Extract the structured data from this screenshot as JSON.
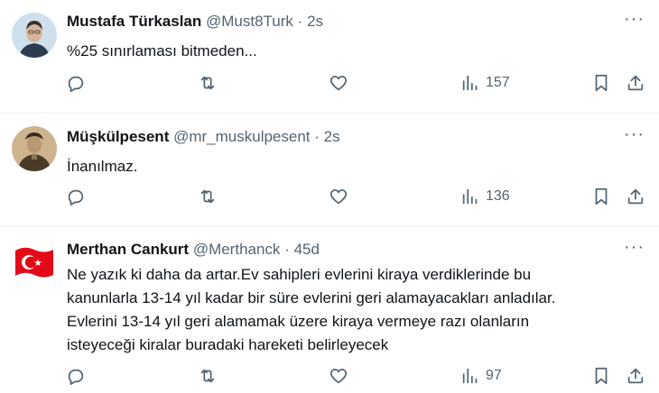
{
  "tweets": [
    {
      "name": "Mustafa Türkaslan",
      "handle": "@Must8Turk",
      "time": "2s",
      "lines": [
        "%25 sınırlaması bitmeden..."
      ],
      "views": "157"
    },
    {
      "name": "Müşkülpesent",
      "handle": "@mr_muskulpesent",
      "time": "2s",
      "lines": [
        "İnanılmaz."
      ],
      "views": "136"
    },
    {
      "name": "Merthan Cankurt",
      "handle": "@Merthanck",
      "time": "45d",
      "lines": [
        "Ne yazık ki daha da artar.Ev sahipleri evlerini kiraya verdiklerinde bu",
        "kanunlarla 13-14 yıl kadar bir süre evlerini geri alamayacakları anladılar.",
        "Evlerini 13-14 yıl geri alamamak üzere kiraya vermeye razı olanların",
        "isteyeceği kiralar buradaki hareketi belirleyecek"
      ],
      "views": "97"
    }
  ],
  "ui": {
    "separator": "·",
    "more": "···"
  },
  "icons": [
    "reply-icon",
    "retweet-icon",
    "like-icon",
    "views-icon",
    "bookmark-icon",
    "share-icon",
    "more-icon"
  ],
  "colors": {
    "text": "#0f1419",
    "muted": "#536471",
    "border": "#eff3f4",
    "flag_red": "#e30a17"
  }
}
